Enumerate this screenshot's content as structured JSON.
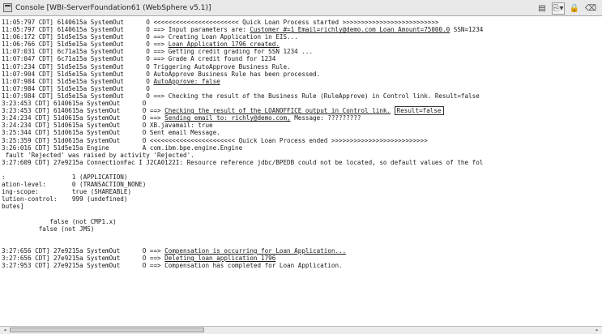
{
  "window": {
    "title": "Console [WBI-ServerFoundation61 (WebSphere v5.1)]",
    "icons": [
      "console-icon",
      "display-console-icon",
      "pin-icon",
      "lock-icon",
      "clear-icon"
    ]
  },
  "toolbar": {
    "btn1": "▤",
    "btn2": "⎘▾",
    "btn3": "🔒",
    "btn4": "⌫"
  },
  "console": {
    "lines": [
      {
        "segments": [
          {
            "text": "11:05:797 CDT] 6140615a SystemOut      O <<<<<<<<<<<<<<<<<<<<<<< Quick Loan Process started >>>>>>>>>>>>>>>>>>>>>>>>>>"
          }
        ]
      },
      {
        "segments": [
          {
            "text": "11:05:797 CDT] 6140615a SystemOut      O ==> Input parameters are: "
          },
          {
            "text": "Customer #=1 Email=richly@demo.com Loan Amount=75000.0",
            "style": "u"
          },
          {
            "text": " SSN=1234"
          }
        ]
      },
      {
        "segments": [
          {
            "text": "11:06:172 CDT] 51d5e15a SystemOut      O ==> Creating Loan Application in EIS..."
          }
        ]
      },
      {
        "segments": [
          {
            "text": "11:06:766 CDT] 51d5e15a SystemOut      O ==> "
          },
          {
            "text": "Loan Application 1796 created.",
            "style": "u"
          }
        ]
      },
      {
        "segments": [
          {
            "text": "11:07:031 CDT] 6c71a15a SystemOut      O ==> Getting credit grading for SSN 1234 ..."
          }
        ]
      },
      {
        "segments": [
          {
            "text": "11:07:047 CDT] 6c71a15a SystemOut      O ==> Grade A credit found for 1234"
          }
        ]
      },
      {
        "segments": [
          {
            "text": "11:07:234 CDT] 51d5e15a SystemOut      O Triggering AutoApprove Business Rule."
          }
        ]
      },
      {
        "segments": [
          {
            "text": "11:07:904 CDT] 51d5e15a SystemOut      O AutoApprove Business Rule has been processed."
          }
        ]
      },
      {
        "segments": [
          {
            "text": "11:07:984 CDT] 51d5e15a SystemOut      O "
          },
          {
            "text": "AutoApprove: false",
            "style": "u"
          }
        ]
      },
      {
        "segments": [
          {
            "text": "11:07:984 CDT] 51d5e15a SystemOut      O"
          }
        ]
      },
      {
        "segments": [
          {
            "text": "11:07:984 CDT] 51d5e15a SystemOut      O ==> Checking the result of the Business Rule (RuleApprove) in Control link. Result=false"
          }
        ]
      },
      {
        "segments": [
          {
            "text": "3:23:453 CDT] 6140615a SystemOut      O"
          }
        ]
      },
      {
        "segments": [
          {
            "text": "3:23:453 CDT] 6140615a SystemOut      O ==> "
          },
          {
            "text": "Checking the result of the LOANOFFICE output in Control link.",
            "style": "u"
          },
          {
            "text": " "
          },
          {
            "text": "Result=false",
            "style": "box"
          }
        ]
      },
      {
        "segments": [
          {
            "text": "3:24:234 CDT] 51d0615a SystemOut      O ==> "
          },
          {
            "text": "Sending email to: richly@demo.com,",
            "style": "u"
          },
          {
            "text": " Message: ?????????"
          }
        ]
      },
      {
        "segments": [
          {
            "text": "3:24:234 CDT] 51d0615a SystemOut      O XB.javamail: true"
          }
        ]
      },
      {
        "segments": [
          {
            "text": "3:25:344 CDT] 51d0615a SystemOut      O Sent email Message."
          }
        ]
      },
      {
        "segments": [
          {
            "text": "3:25:359 CDT] 51d0615a SystemOut      O <<<<<<<<<<<<<<<<<<<<<<< Quick Loan Process ended >>>>>>>>>>>>>>>>>>>>>>>>>>"
          }
        ]
      },
      {
        "segments": [
          {
            "text": "3:26:016 CDT] 51d5e15a Engine         A com.ibm.bpe.engine.Engine"
          }
        ]
      },
      {
        "segments": [
          {
            "text": " fault 'Rejected' was raised by activity 'Rejected'."
          }
        ]
      },
      {
        "segments": [
          {
            "text": "3:27:609 CDT] 27e9215a ConnectionFac I J2CA0122I: Resource reference jdbc/BPEDB could not be located, so default values of the fol"
          }
        ]
      },
      {
        "segments": [
          {
            "text": ""
          }
        ]
      },
      {
        "segments": [
          {
            "text": ":                  1 (APPLICATION)"
          }
        ]
      },
      {
        "segments": [
          {
            "text": "ation-level:       0 (TRANSACTION_NONE)"
          }
        ]
      },
      {
        "segments": [
          {
            "text": "ing-scope:         true (SHAREABLE)"
          }
        ]
      },
      {
        "segments": [
          {
            "text": "lution-control:    999 (undefined)"
          }
        ]
      },
      {
        "segments": [
          {
            "text": "butes]"
          }
        ]
      },
      {
        "segments": [
          {
            "text": ""
          }
        ]
      },
      {
        "segments": [
          {
            "text": "             false (not CMP1.x)"
          }
        ]
      },
      {
        "segments": [
          {
            "text": "          false (not JMS)"
          }
        ]
      },
      {
        "segments": [
          {
            "text": ""
          }
        ]
      },
      {
        "segments": [
          {
            "text": ""
          }
        ]
      },
      {
        "segments": [
          {
            "text": "3:27:656 CDT] 27e9215a SystemOut      O ==> "
          },
          {
            "text": "Compensation is occurring for Loan Application...",
            "style": "u"
          }
        ]
      },
      {
        "segments": [
          {
            "text": "3:27:656 CDT] 27e9215a SystemOut      O ==> "
          },
          {
            "text": "Deleting loan application 1796",
            "style": "u"
          }
        ]
      },
      {
        "segments": [
          {
            "text": "3:27:953 CDT] 27e9215a SystemOut      O ==> Compensation has completed for Loan Application."
          }
        ]
      }
    ]
  }
}
